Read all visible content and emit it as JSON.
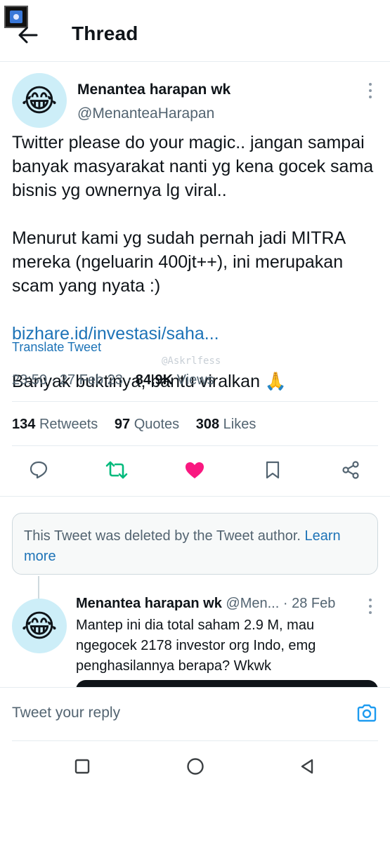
{
  "header": {
    "title": "Thread",
    "back_icon": "arrow-left-icon"
  },
  "main_tweet": {
    "author_name": "Menantea harapan wk",
    "author_handle": "@MenanteaHarapan",
    "avatar_emoji": "😂",
    "body_line1": "Twitter please do your magic.. jangan sampai banyak masyarakat nanti yg kena gocek sama bisnis yg ownernya lg viral..",
    "body_line2": "Menurut kami yg sudah pernah jadi MITRA mereka (ngeluarin 400jt++), ini merupakan scam yang nyata :)",
    "link": "bizhare.id/investasi/saha...",
    "body_line3": "Banyak buktinya, bantu viralkan 🙏",
    "translate_label": "Translate Tweet",
    "watermark": "@Askrlfess",
    "time": "23:50",
    "date": "27 Feb 23",
    "views_count": "84.9K",
    "views_label": "Views",
    "retweets_count": "134",
    "retweets_label": "Retweets",
    "quotes_count": "97",
    "quotes_label": "Quotes",
    "likes_count": "308",
    "likes_label": "Likes",
    "like_color": "#f91880",
    "retweet_color": "#00ba7c"
  },
  "deleted_notice": {
    "text": "This Tweet was deleted by the Tweet author.",
    "learn_more": "Learn more"
  },
  "reply_tweet": {
    "author_name": "Menantea harapan wk",
    "author_handle": "@Men...",
    "date": "· 28 Feb",
    "avatar_emoji": "😂",
    "body": "Mantep ini dia total saham 2.9 M, mau ngegocek 2178 investor org Indo, emg penghasilannya berapa? Wkwk"
  },
  "reply_bar": {
    "placeholder": "Tweet your reply",
    "camera_icon": "camera-icon"
  },
  "nav": {
    "recents_icon": "square-icon",
    "home_icon": "circle-icon",
    "back_icon": "triangle-back-icon"
  }
}
